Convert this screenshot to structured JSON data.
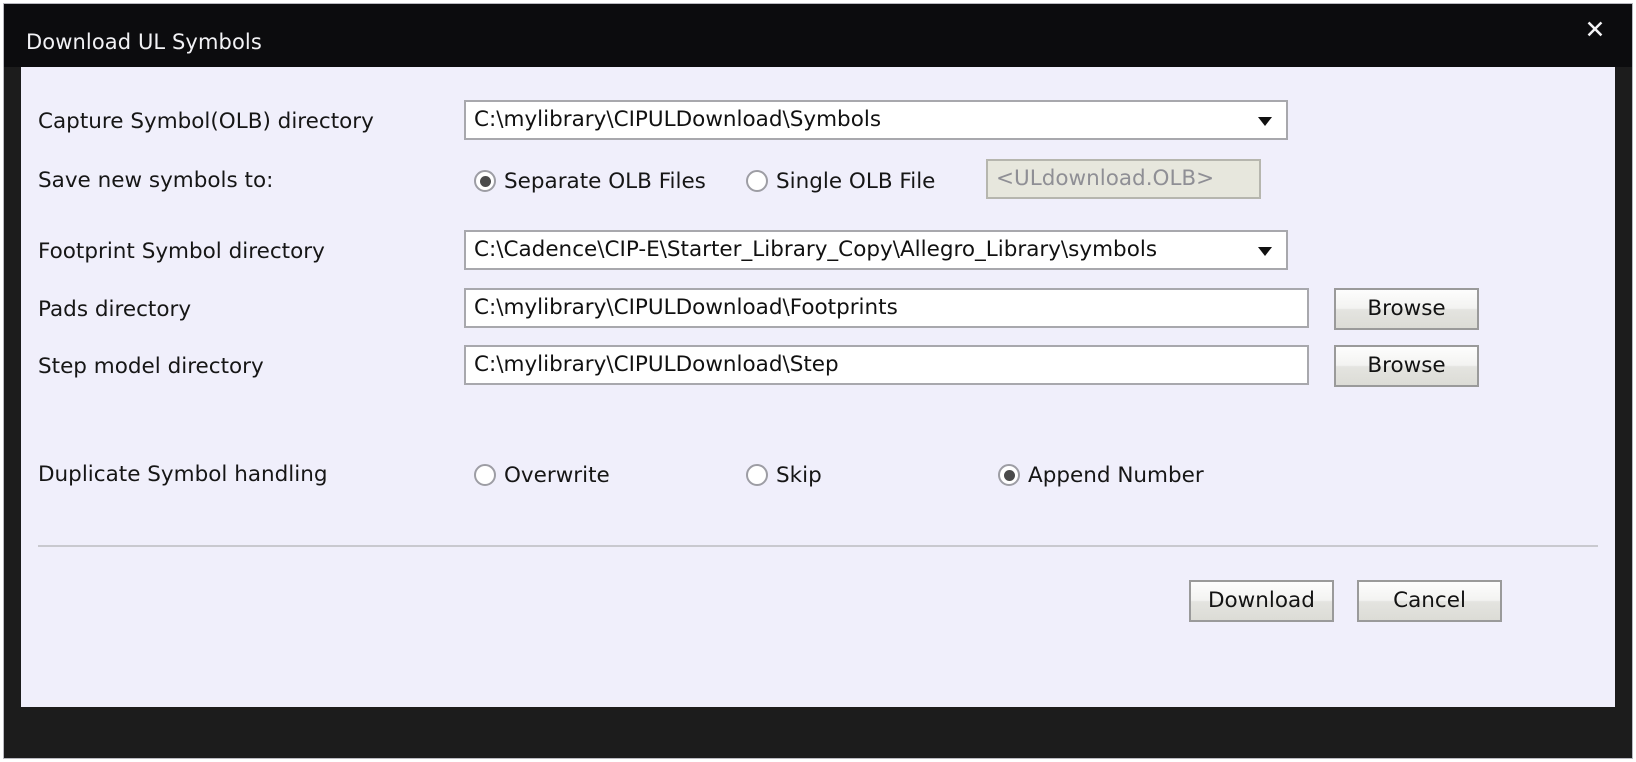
{
  "window": {
    "title": "Download UL Symbols",
    "close_icon": "close-icon",
    "close_glyph": "✕"
  },
  "colors": {
    "titlebar_bg": "#0c0c0e",
    "frame_bg": "#1c1c1c",
    "content_bg": "#f0effb",
    "field_border": "#a8a8ad",
    "disabled_bg": "#e7e7dd",
    "text": "#161616"
  },
  "form": {
    "capture_symbol": {
      "label": "Capture Symbol(OLB) directory",
      "value": "C:\\mylibrary\\CIPULDownload\\Symbols",
      "control": "combobox",
      "arrow_icon": "chevron-down-icon"
    },
    "save_new_symbols": {
      "label": "Save new symbols to:",
      "options": [
        {
          "label": "Separate OLB Files",
          "selected": true
        },
        {
          "label": "Single OLB File",
          "selected": false
        }
      ],
      "olb_file_field": {
        "value": "<ULdownload.OLB>",
        "disabled": true
      }
    },
    "footprint_symbol": {
      "label": "Footprint Symbol directory",
      "value": "C:\\Cadence\\CIP-E\\Starter_Library_Copy\\Allegro_Library\\symbols",
      "control": "combobox",
      "arrow_icon": "chevron-down-icon"
    },
    "pads_directory": {
      "label": "Pads directory",
      "value": "C:\\mylibrary\\CIPULDownload\\Footprints",
      "browse_label": "Browse"
    },
    "step_model_directory": {
      "label": "Step model directory",
      "value": "C:\\mylibrary\\CIPULDownload\\Step",
      "browse_label": "Browse"
    },
    "duplicate_symbol_handling": {
      "label": "Duplicate Symbol handling",
      "options": [
        {
          "label": "Overwrite",
          "selected": false
        },
        {
          "label": "Skip",
          "selected": false
        },
        {
          "label": "Append Number",
          "selected": true
        }
      ]
    }
  },
  "footer": {
    "download_label": "Download",
    "cancel_label": "Cancel"
  }
}
